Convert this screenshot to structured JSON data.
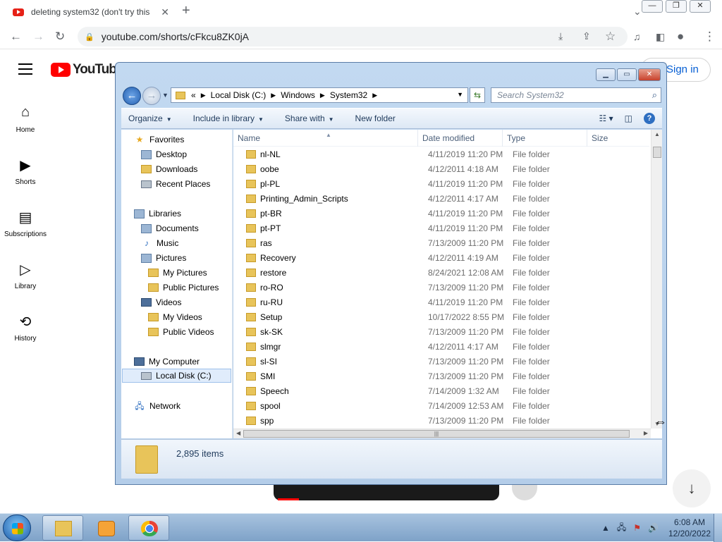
{
  "browser": {
    "tab_title": "deleting system32 (don't try this",
    "url": "youtube.com/shorts/cFkcu8ZK0jA"
  },
  "youtube": {
    "logo_text": "YouTube",
    "sign_in": "Sign in",
    "sidebar": [
      {
        "label": "Home",
        "icon": "home-icon"
      },
      {
        "label": "Shorts",
        "icon": "shorts-icon"
      },
      {
        "label": "Subscriptions",
        "icon": "subscriptions-icon"
      },
      {
        "label": "Library",
        "icon": "library-icon"
      },
      {
        "label": "History",
        "icon": "history-icon"
      }
    ]
  },
  "explorer": {
    "address": {
      "prefix": "«",
      "crumbs": [
        "Local Disk (C:)",
        "Windows",
        "System32"
      ]
    },
    "search_placeholder": "Search System32",
    "commands": [
      "Organize",
      "Include in library",
      "Share with",
      "New folder"
    ],
    "nav": {
      "favorites": {
        "label": "Favorites",
        "items": [
          "Desktop",
          "Downloads",
          "Recent Places"
        ]
      },
      "libraries": {
        "label": "Libraries",
        "items": [
          "Documents",
          "Music",
          "Pictures",
          "My Pictures",
          "Public Pictures",
          "Videos",
          "My Videos",
          "Public Videos"
        ]
      },
      "computer": {
        "label": "My Computer",
        "items": [
          "Local Disk (C:)"
        ]
      },
      "network": {
        "label": "Network"
      }
    },
    "columns": [
      "Name",
      "Date modified",
      "Type",
      "Size"
    ],
    "files": [
      {
        "name": "nl-NL",
        "date": "4/11/2019 11:20 PM",
        "type": "File folder"
      },
      {
        "name": "oobe",
        "date": "4/12/2011 4:18 AM",
        "type": "File folder"
      },
      {
        "name": "pl-PL",
        "date": "4/11/2019 11:20 PM",
        "type": "File folder"
      },
      {
        "name": "Printing_Admin_Scripts",
        "date": "4/12/2011 4:17 AM",
        "type": "File folder"
      },
      {
        "name": "pt-BR",
        "date": "4/11/2019 11:20 PM",
        "type": "File folder"
      },
      {
        "name": "pt-PT",
        "date": "4/11/2019 11:20 PM",
        "type": "File folder"
      },
      {
        "name": "ras",
        "date": "7/13/2009 11:20 PM",
        "type": "File folder"
      },
      {
        "name": "Recovery",
        "date": "4/12/2011 4:19 AM",
        "type": "File folder"
      },
      {
        "name": "restore",
        "date": "8/24/2021 12:08 AM",
        "type": "File folder"
      },
      {
        "name": "ro-RO",
        "date": "7/13/2009 11:20 PM",
        "type": "File folder"
      },
      {
        "name": "ru-RU",
        "date": "4/11/2019 11:20 PM",
        "type": "File folder"
      },
      {
        "name": "Setup",
        "date": "10/17/2022 8:55 PM",
        "type": "File folder"
      },
      {
        "name": "sk-SK",
        "date": "7/13/2009 11:20 PM",
        "type": "File folder"
      },
      {
        "name": "slmgr",
        "date": "4/12/2011 4:17 AM",
        "type": "File folder"
      },
      {
        "name": "sl-SI",
        "date": "7/13/2009 11:20 PM",
        "type": "File folder"
      },
      {
        "name": "SMI",
        "date": "7/13/2009 11:20 PM",
        "type": "File folder"
      },
      {
        "name": "Speech",
        "date": "7/14/2009 1:32 AM",
        "type": "File folder"
      },
      {
        "name": "spool",
        "date": "7/14/2009 12:53 AM",
        "type": "File folder"
      },
      {
        "name": "spp",
        "date": "7/13/2009 11:20 PM",
        "type": "File folder"
      }
    ],
    "item_count": "2,895 items"
  },
  "taskbar": {
    "time": "6:08 AM",
    "date": "12/20/2022"
  }
}
